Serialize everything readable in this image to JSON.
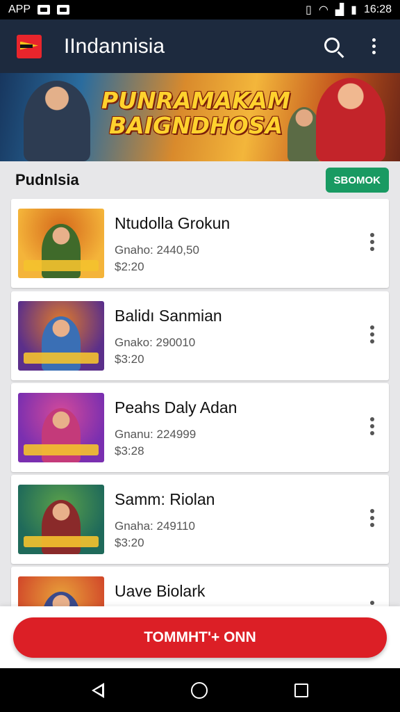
{
  "status_bar": {
    "left_text": "APP",
    "time": "16:28"
  },
  "app_bar": {
    "flag_icon": "flag-icon",
    "title": "IIndannisia",
    "search_icon": "search-icon",
    "more_icon": "more-vert-icon"
  },
  "banner": {
    "line1": "PUNRAMAKAM",
    "line2": "BAIGNDHOSA"
  },
  "section": {
    "title": "Pudnlsia",
    "button_label": "SBOMOK"
  },
  "items": [
    {
      "title": "Ntudolla Grokun",
      "subtitle": "Gnaho: 2440,50",
      "price": "$2:20",
      "thumb_colors": [
        "#f4b43a",
        "#d5681b",
        "#3f6a2a"
      ]
    },
    {
      "title": "Balidı Sanmian",
      "subtitle": "Gnako: 290010",
      "price": "$3:20",
      "thumb_colors": [
        "#5b2f8a",
        "#e07a2a",
        "#3a6fb5"
      ]
    },
    {
      "title": "Peahs Daly Adan",
      "subtitle": "Gnanu: 224999",
      "price": "$3:28",
      "thumb_colors": [
        "#7a2fb0",
        "#d44a9a",
        "#c43a7a"
      ]
    },
    {
      "title": "Samm: Riolan",
      "subtitle": "Gnaha: 249110",
      "price": "$3:20",
      "thumb_colors": [
        "#1f6a5a",
        "#5aa04a",
        "#8a2a2a"
      ]
    },
    {
      "title": "Uave Biolark",
      "subtitle": "",
      "price": "",
      "thumb_colors": [
        "#d24a2a",
        "#e8a23a",
        "#3a4a8a"
      ]
    }
  ],
  "cta": {
    "label": "TOMMHT'+ ONN"
  },
  "colors": {
    "app_bar": "#1d2a3e",
    "section_button": "#199a62",
    "cta": "#dc1f26"
  }
}
